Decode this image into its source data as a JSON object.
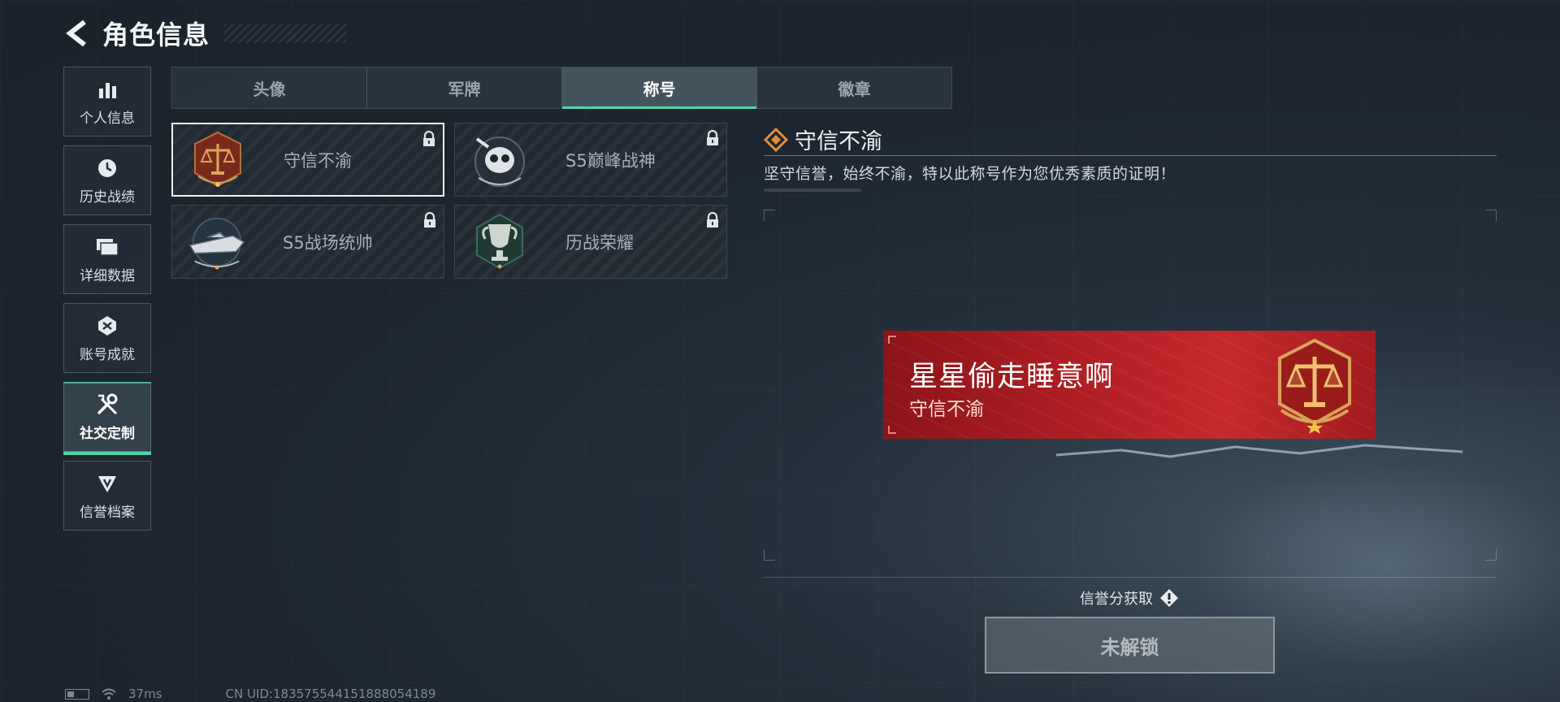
{
  "header": {
    "title": "角色信息"
  },
  "sidebar": {
    "items": [
      {
        "label": "个人信息",
        "icon": "bar-chart-icon"
      },
      {
        "label": "历史战绩",
        "icon": "clock-icon"
      },
      {
        "label": "详细数据",
        "icon": "folders-icon"
      },
      {
        "label": "账号成就",
        "icon": "achievement-icon"
      },
      {
        "label": "社交定制",
        "icon": "tools-icon",
        "active": true
      },
      {
        "label": "信誉档案",
        "icon": "credit-shield-icon"
      }
    ]
  },
  "tabs": [
    {
      "label": "头像"
    },
    {
      "label": "军牌"
    },
    {
      "label": "称号",
      "active": true
    },
    {
      "label": "徽章"
    }
  ],
  "titles": [
    {
      "name": "守信不渝",
      "icon": "scales-emblem-icon",
      "selected": true,
      "locked": true
    },
    {
      "name": "S5巅峰战神",
      "icon": "skull-emblem-icon",
      "locked": true
    },
    {
      "name": "S5战场统帅",
      "icon": "boat-emblem-icon",
      "locked": true
    },
    {
      "name": "历战荣耀",
      "icon": "trophy-emblem-icon",
      "locked": true
    }
  ],
  "detail": {
    "title": "守信不渝",
    "description": "坚守信誉，始终不渝，特以此称号作为您优秀素质的证明！"
  },
  "banner": {
    "player_name": "星星偷走睡意啊",
    "title_text": "守信不渝"
  },
  "action": {
    "source_label": "信誉分获取",
    "button_label": "未解锁"
  },
  "status": {
    "ping": "37ms",
    "uid": "CN UID:183575544151888054189"
  },
  "colors": {
    "accent": "#4fd6a4",
    "banner_red": "#b42025",
    "gold": "#d7a35b"
  }
}
